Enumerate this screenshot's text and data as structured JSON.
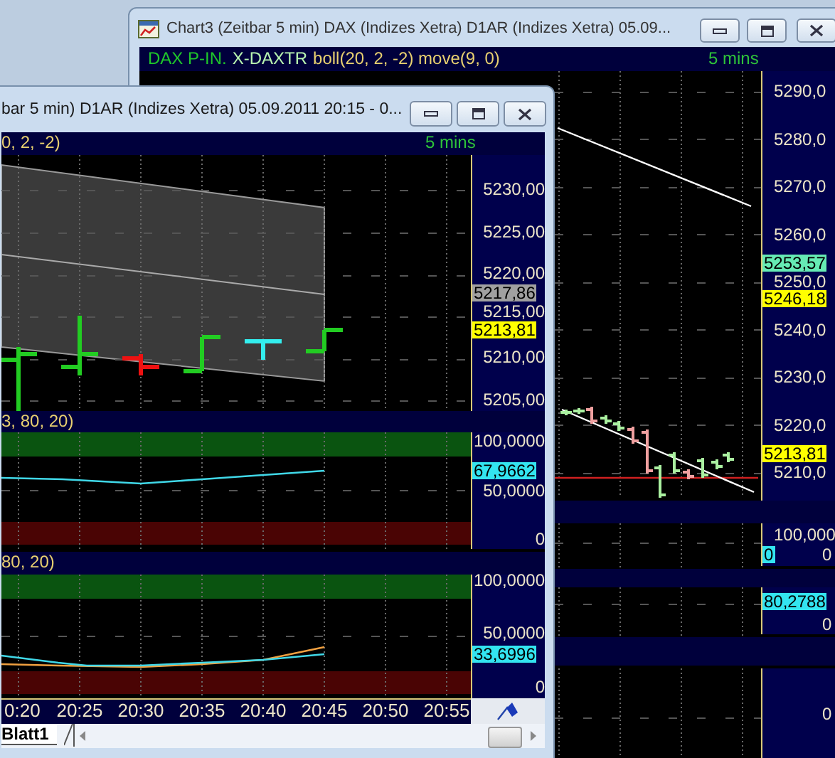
{
  "back_window": {
    "title": "Chart3 (Zeitbar 5 min)  DAX (Indizes Xetra) D1AR (Indizes Xetra) 05.09...",
    "legend": [
      {
        "text": "DAX P-IN.",
        "color": "#1fc62a"
      },
      {
        "text": "X-DAXTR",
        "color": "#b8f4b0"
      },
      {
        "text": "boll(20, 2, -2) move(9, 0)",
        "color": "#e8d070"
      }
    ],
    "interval": "5 mins",
    "price_axis": {
      "labels": [
        "5290,0",
        "5280,0",
        "5270,0",
        "5260,0",
        "5250,0",
        "5240,0",
        "5230,0",
        "5220,0",
        "5210,0"
      ],
      "tags": [
        {
          "text": "5253,57",
          "color": "#66eab4"
        },
        {
          "text": "5246,18",
          "color": "#ffff00"
        },
        {
          "text": "5213,81",
          "color": "#ffff00"
        }
      ]
    },
    "panel_axes": [
      {
        "labels": [
          "100,000",
          "0"
        ],
        "tags": [
          {
            "text": "0",
            "color": "#33e4f0"
          }
        ]
      },
      {
        "labels": [
          "0"
        ],
        "tags": [
          {
            "text": "80,2788",
            "color": "#33e4f0"
          }
        ]
      },
      {
        "labels": [
          "0"
        ]
      }
    ]
  },
  "front_window": {
    "title": "bar 5 min)  D1AR (Indizes Xetra) 05.09.2011 20:15 - 0...",
    "legend": [
      {
        "text": "0, 2, -2)"
      }
    ],
    "interval": "5 mins",
    "price_axis": {
      "labels": [
        "5230,00",
        "5225,00",
        "5220,00",
        "5215,00",
        "5210,00",
        "5205,00"
      ],
      "tags": [
        {
          "text": "5217,86",
          "color": "#a0a0a0"
        },
        {
          "text": "5213,81",
          "color": "#ffff00"
        }
      ]
    },
    "panels": [
      {
        "legend": "3, 80, 20)",
        "axis": {
          "labels": [
            "100,0000",
            "50,0000",
            "0"
          ],
          "tags": [
            {
              "text": "67,9662",
              "color": "#33e4f0"
            }
          ]
        }
      },
      {
        "legend": "80, 20)",
        "axis": {
          "labels": [
            "100,0000",
            "50,0000",
            "0"
          ],
          "tags": [
            {
              "text": "33,6996",
              "color": "#33e4f0"
            }
          ]
        }
      }
    ],
    "time_axis": [
      "0:20",
      "20:25",
      "20:30",
      "20:35",
      "20:40",
      "20:45",
      "20:50",
      "20:55"
    ],
    "sheet_tabs": [
      {
        "label": "Blatt1",
        "selected": true
      }
    ]
  }
}
